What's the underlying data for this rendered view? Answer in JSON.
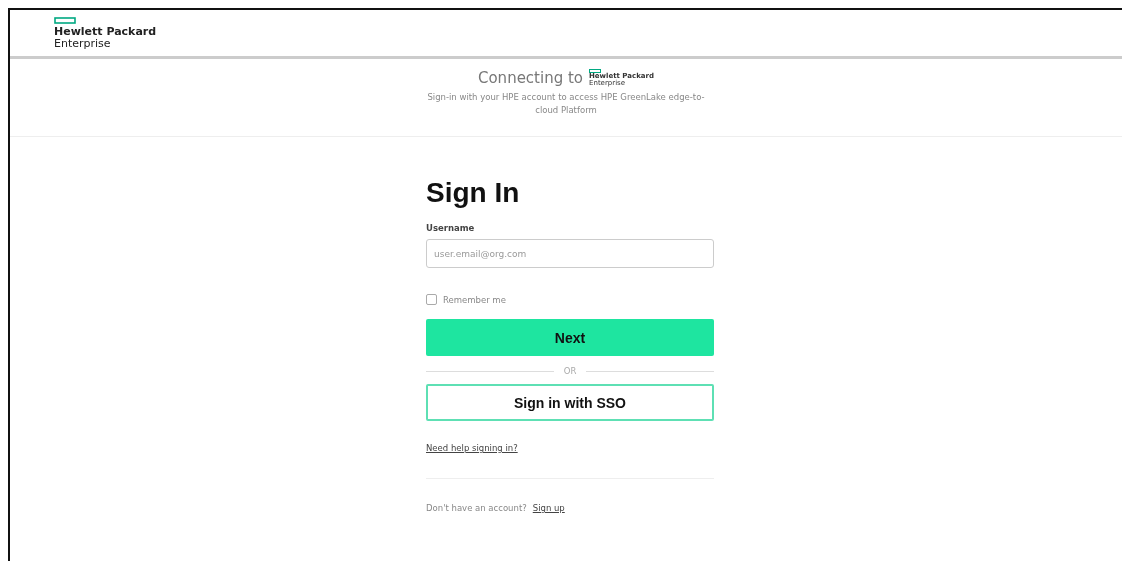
{
  "header": {
    "logo": {
      "line1": "Hewlett Packard",
      "line2": "Enterprise"
    }
  },
  "connecting": {
    "title": "Connecting to",
    "logo": {
      "line1": "Hewlett Packard",
      "line2": "Enterprise"
    },
    "subtitle": "Sign-in with your HPE account to access HPE GreenLake edge-to-cloud Platform"
  },
  "form": {
    "title": "Sign In",
    "username": {
      "label": "Username",
      "placeholder": "user.email@org.com"
    },
    "remember": {
      "label": "Remember me",
      "checked": false
    },
    "next_button": "Next",
    "divider": "OR",
    "sso_button": "Sign in with SSO",
    "help_link": "Need help signing in?",
    "signup": {
      "text": "Don't have an account?",
      "link": "Sign up"
    }
  }
}
